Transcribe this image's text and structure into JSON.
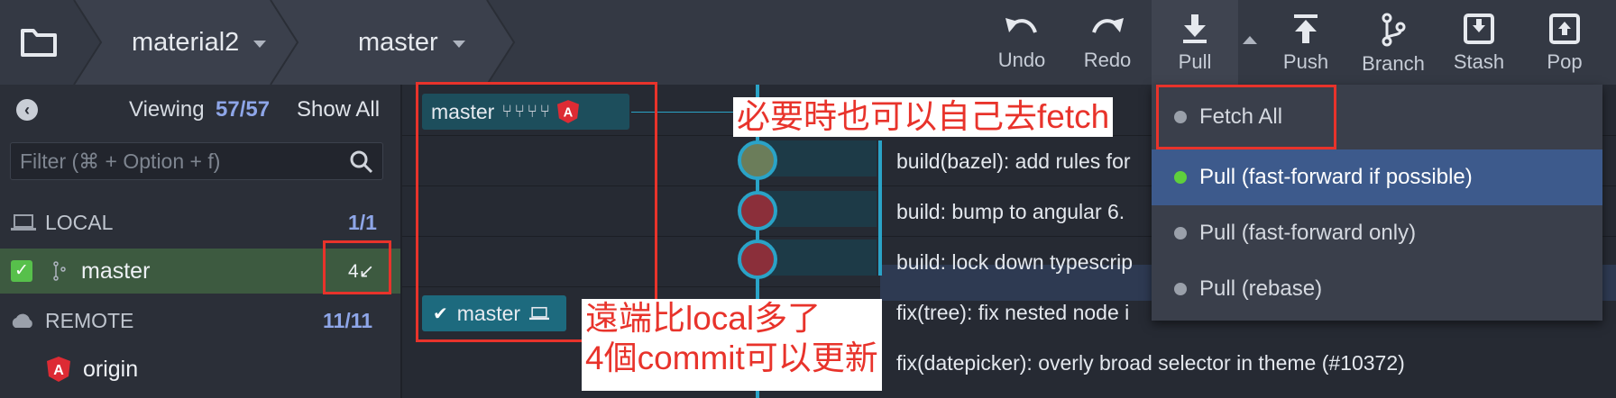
{
  "toolbar": {
    "repo": "material2",
    "branch": "master",
    "buttons": [
      {
        "label": "Undo",
        "icon": "undo-icon"
      },
      {
        "label": "Redo",
        "icon": "redo-icon"
      },
      {
        "label": "Pull",
        "icon": "pull-icon"
      },
      {
        "label": "Push",
        "icon": "push-icon"
      },
      {
        "label": "Branch",
        "icon": "branch-icon"
      },
      {
        "label": "Stash",
        "icon": "stash-icon"
      },
      {
        "label": "Pop",
        "icon": "pop-icon"
      }
    ]
  },
  "sidebar": {
    "viewing_label": "Viewing",
    "viewing_count": "57/57",
    "show_all": "Show All",
    "filter_placeholder": "Filter (⌘ + Option + f)",
    "local_label": "LOCAL",
    "local_count": "1/1",
    "local_branch": "master",
    "behind_badge": "4↙",
    "remote_label": "REMOTE",
    "remote_count": "11/11",
    "remote_origin": "origin"
  },
  "graph": {
    "remote_branch_label": "master",
    "local_branch_label": "master",
    "commits": [
      "build(bazel): add rules for",
      "build: bump to angular 6.",
      "build: lock down typescrip",
      "fix(tree): fix nested node i",
      "fix(datepicker): overly broad selector in theme (#10372)"
    ]
  },
  "pull_menu": {
    "items": [
      {
        "label": "Fetch All",
        "active": false
      },
      {
        "label": "Pull (fast-forward if possible)",
        "active": true
      },
      {
        "label": "Pull (fast-forward only)",
        "active": false
      },
      {
        "label": "Pull (rebase)",
        "active": false
      }
    ]
  },
  "annotations": {
    "fetch_note": "必要時也可以自己去fetch",
    "remote_note_line1": "遠端比local多了",
    "remote_note_line2": "4個commit可以更新"
  },
  "colors": {
    "accent": "#2aa3c7",
    "annotation": "#e8332b",
    "active_dot": "#5fcf3c"
  }
}
